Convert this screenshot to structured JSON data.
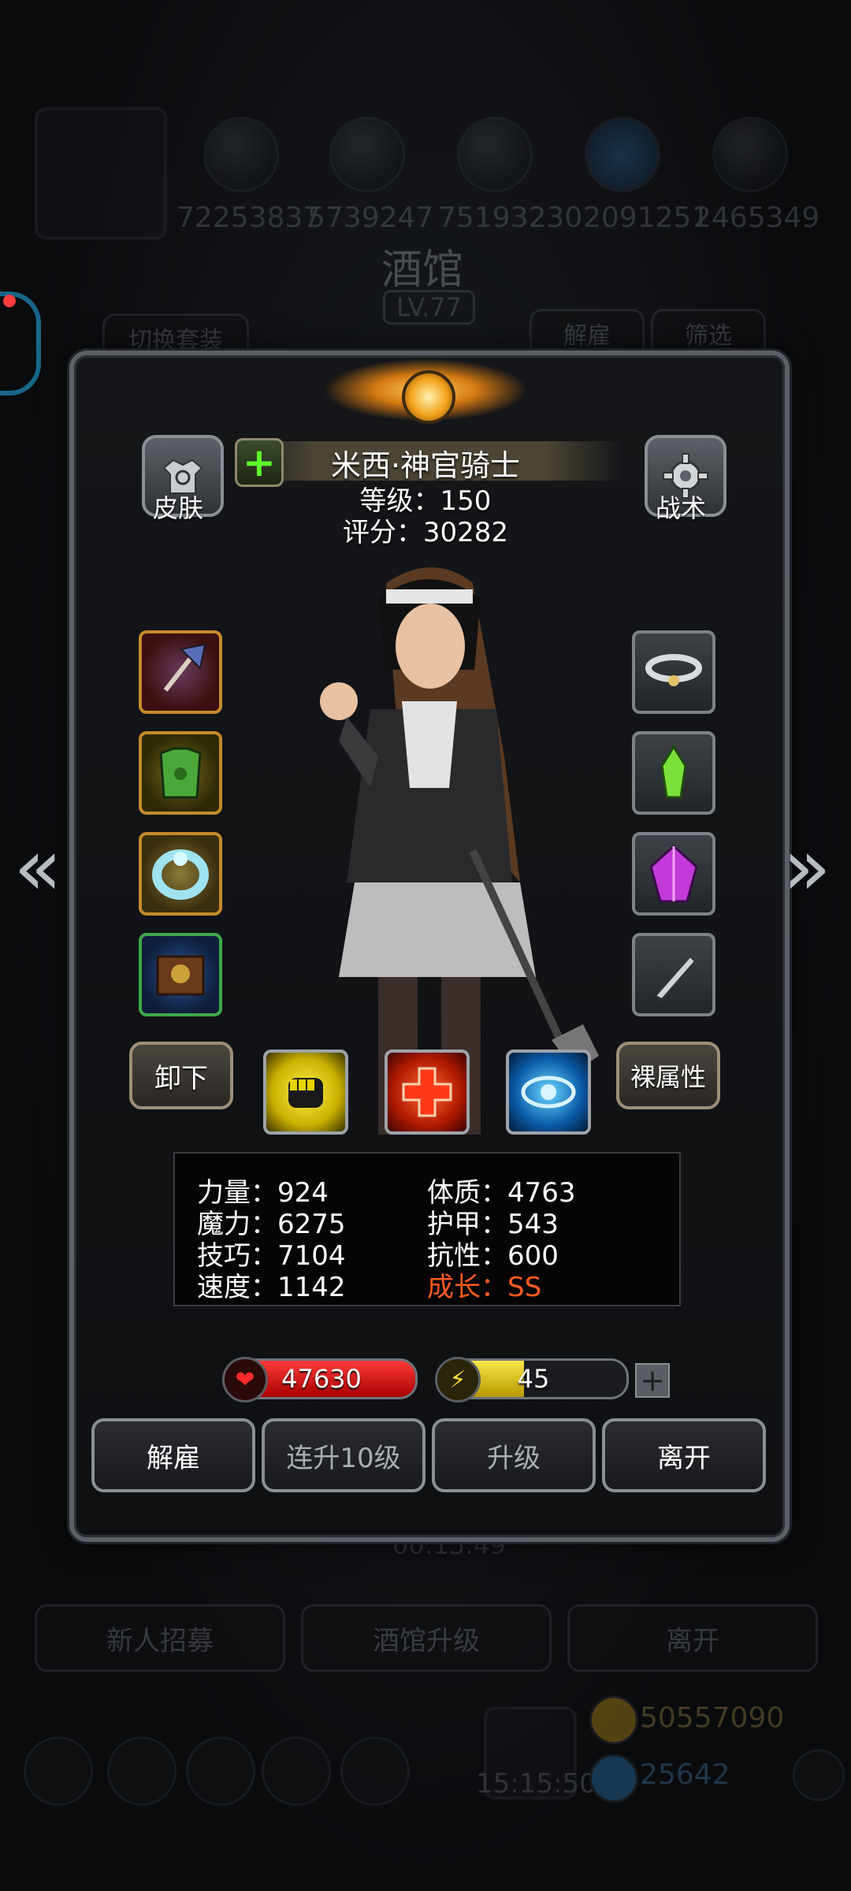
{
  "background": {
    "id_numbers": [
      "72253837",
      "5739247",
      "75193230",
      "2091251",
      "2465349"
    ],
    "title": "酒馆",
    "level": "LV.77",
    "switch_outfit": "切换套装",
    "dismiss_tab": "解雇",
    "filter_tab": "筛选",
    "timer": "00:15:49",
    "recruit_button": "新人招募",
    "upgrade_tavern_button": "酒馆升级",
    "leave_button": "离开",
    "gold": "50557090",
    "gems": "25642",
    "clock": "15:15:50"
  },
  "hero": {
    "skin_label": "皮肤",
    "tactics_label": "战术",
    "name": "米西·神官骑士",
    "level_text": "等级：150",
    "score_text": "评分：30282",
    "unequip_label": "卸下",
    "naked_stats_label": "裸属性"
  },
  "stats": {
    "strength": "力量：924",
    "magic": "魔力：6275",
    "skill": "技巧：7104",
    "speed": "速度：1142",
    "constitution": "体质：4763",
    "armor": "护甲：543",
    "resistance": "抗性：600",
    "growth": "成长：SS"
  },
  "bars": {
    "hp": "47630",
    "hp_fill": 1.0,
    "energy": "45",
    "energy_fill": 0.45
  },
  "actions": {
    "dismiss": "解雇",
    "level_up_10": "连升10级",
    "level_up": "升级",
    "leave": "离开"
  },
  "colors": {
    "accent_gold": "#c48a2c",
    "growth_orange": "#ff5a1f",
    "hp_red": "#d21010",
    "energy_yellow": "#e7cf2a"
  }
}
